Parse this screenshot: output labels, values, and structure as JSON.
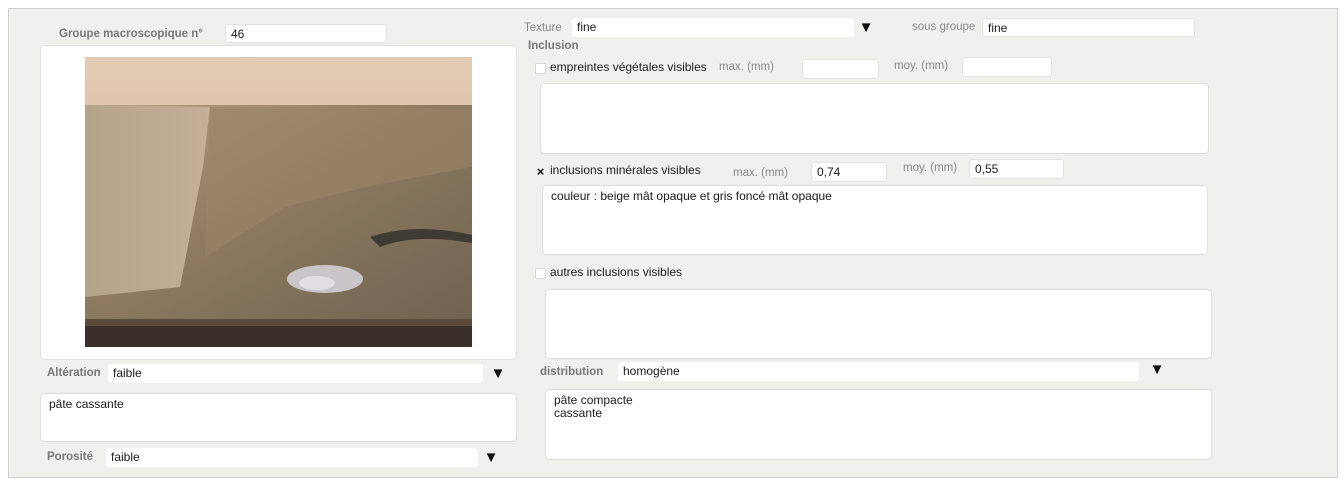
{
  "groupe": {
    "label": "Groupe macroscopique n°",
    "value": "46"
  },
  "texture": {
    "label": "Texture",
    "value": "fine",
    "arrow": "▼"
  },
  "sous_groupe": {
    "label": "sous groupe",
    "value": "fine"
  },
  "inclusion": {
    "title": "Inclusion"
  },
  "vegetales": {
    "checked": false,
    "check_mark": "",
    "label": "empreintes végétales visibles",
    "max_label": "max. (mm)",
    "max_value": "",
    "moy_label": "moy. (mm)",
    "moy_value": "",
    "notes": ""
  },
  "minerales": {
    "checked": true,
    "check_mark": "×",
    "label": "inclusions minérales visibles",
    "max_label": "max. (mm)",
    "max_value": "0,74",
    "moy_label": "moy. (mm)",
    "moy_value": "0,55",
    "notes": "couleur : beige mât opaque et gris foncé mât opaque"
  },
  "autres": {
    "checked": false,
    "check_mark": "",
    "label": "autres inclusions visibles",
    "notes": ""
  },
  "alteration": {
    "label": "Altération",
    "value": "faible",
    "arrow": "▼",
    "notes": "pâte cassante"
  },
  "porosite": {
    "label": "Porosité",
    "value": "faible",
    "arrow": "▼"
  },
  "distribution": {
    "label": "distribution",
    "value": "homogène",
    "arrow": "▼",
    "notes": "pâte compacte\ncassante"
  },
  "colors": {
    "panel": "#f0f0ef",
    "field": "#ffffff",
    "label": "#777777"
  }
}
